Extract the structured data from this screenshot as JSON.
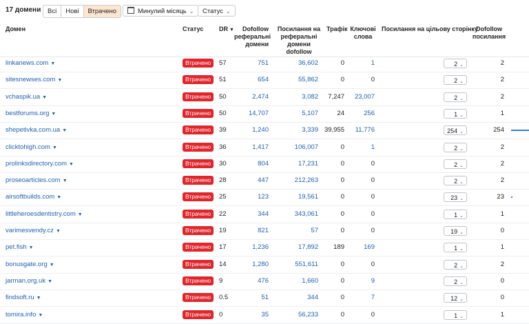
{
  "toolbar": {
    "count_label": "17 домени",
    "filters": [
      "Всі",
      "Нові",
      "Втрачено"
    ],
    "active_filter": "Втрачено",
    "period_label": "Минулий місяць",
    "status_label": "Статус"
  },
  "columns": {
    "domain": "Домен",
    "status": "Статус",
    "dr": "DR",
    "dofollow_ref": [
      "Dofollow",
      "реферальні",
      "домени"
    ],
    "links_ref": [
      "Посилання на",
      "реферальні",
      "домени",
      "dofollow"
    ],
    "traffic": "Трафік",
    "keywords": [
      "Ключові",
      "слова"
    ],
    "target_links": "Посилання на цільову сторінку",
    "dofollow_links": [
      "Dofollow",
      "посилання"
    ]
  },
  "colors": {
    "accent": "#1f5fb3",
    "badge": "#e0252b",
    "active_filter_bg": "#fde6cf",
    "bar": "#2d7fd3"
  },
  "rows": [
    {
      "domain": "linkanews.com",
      "status": "Втрачено",
      "dr": "57",
      "dofollow_ref": "751",
      "links_ref": "36,602",
      "traffic": "0",
      "keywords": "1",
      "target": "2",
      "dofollow_links": "2",
      "bar": 0.005
    },
    {
      "domain": "sitesnewses.com",
      "status": "Втрачено",
      "dr": "51",
      "dofollow_ref": "654",
      "links_ref": "55,862",
      "traffic": "0",
      "keywords": "0",
      "target": "2",
      "dofollow_links": "2",
      "bar": 0.005
    },
    {
      "domain": "vchaspik.ua",
      "status": "Втрачено",
      "dr": "50",
      "dofollow_ref": "2,474",
      "links_ref": "3,082",
      "traffic": "7,247",
      "keywords": "23,007",
      "target": "2",
      "dofollow_links": "2",
      "bar": 0.005
    },
    {
      "domain": "bestforums.org",
      "status": "Втрачено",
      "dr": "50",
      "dofollow_ref": "14,707",
      "links_ref": "5,107",
      "traffic": "24",
      "keywords": "256",
      "target": "1",
      "dofollow_links": "1",
      "bar": 0.003
    },
    {
      "domain": "shepetivka.com.ua",
      "status": "Втрачено",
      "dr": "39",
      "dofollow_ref": "1,240",
      "links_ref": "3,339",
      "traffic": "39,955",
      "keywords": "11,776",
      "target": "254",
      "dofollow_links": "254",
      "bar": 1.0
    },
    {
      "domain": "clicktohigh.com",
      "status": "Втрачено",
      "dr": "36",
      "dofollow_ref": "1,417",
      "links_ref": "106,007",
      "traffic": "0",
      "keywords": "1",
      "target": "2",
      "dofollow_links": "2",
      "bar": 0.005
    },
    {
      "domain": "prolinksdirectory.com",
      "status": "Втрачено",
      "dr": "30",
      "dofollow_ref": "804",
      "links_ref": "17,231",
      "traffic": "0",
      "keywords": "0",
      "target": "2",
      "dofollow_links": "2",
      "bar": 0.005
    },
    {
      "domain": "proseoarticles.com",
      "status": "Втрачено",
      "dr": "28",
      "dofollow_ref": "447",
      "links_ref": "212,263",
      "traffic": "0",
      "keywords": "0",
      "target": "2",
      "dofollow_links": "2",
      "bar": 0.005
    },
    {
      "domain": "airsoftbuilds.com",
      "status": "Втрачено",
      "dr": "25",
      "dofollow_ref": "123",
      "links_ref": "19,561",
      "traffic": "0",
      "keywords": "0",
      "target": "23",
      "dofollow_links": "23",
      "bar": 0.09
    },
    {
      "domain": "littleheroesdentistry.com",
      "status": "Втрачено",
      "dr": "22",
      "dofollow_ref": "344",
      "links_ref": "343,061",
      "traffic": "0",
      "keywords": "0",
      "target": "1",
      "dofollow_links": "1",
      "bar": 0.003
    },
    {
      "domain": "varimesvendy.cz",
      "status": "Втрачено",
      "dr": "19",
      "dofollow_ref": "821",
      "links_ref": "57",
      "traffic": "0",
      "keywords": "0",
      "target": "19",
      "dofollow_links": "0",
      "bar": 0
    },
    {
      "domain": "pet.fish",
      "status": "Втрачено",
      "dr": "17",
      "dofollow_ref": "1,236",
      "links_ref": "17,892",
      "traffic": "189",
      "keywords": "169",
      "target": "1",
      "dofollow_links": "1",
      "bar": 0.003
    },
    {
      "domain": "bonusgate.org",
      "status": "Втрачено",
      "dr": "14",
      "dofollow_ref": "1,280",
      "links_ref": "551,611",
      "traffic": "0",
      "keywords": "0",
      "target": "2",
      "dofollow_links": "2",
      "bar": 0.005
    },
    {
      "domain": "jarman.org.uk",
      "status": "Втрачено",
      "dr": "9",
      "dofollow_ref": "476",
      "links_ref": "1,660",
      "traffic": "0",
      "keywords": "9",
      "target": "2",
      "dofollow_links": "0",
      "bar": 0
    },
    {
      "domain": "findsoft.ru",
      "status": "Втрачено",
      "dr": "0.5",
      "dofollow_ref": "51",
      "links_ref": "344",
      "traffic": "0",
      "keywords": "7",
      "target": "12",
      "dofollow_links": "0",
      "bar": 0
    },
    {
      "domain": "tomira.info",
      "status": "Втрачено",
      "dr": "0",
      "dofollow_ref": "35",
      "links_ref": "56,233",
      "traffic": "0",
      "keywords": "0",
      "target": "1",
      "dofollow_links": "1",
      "bar": 0.003
    }
  ]
}
